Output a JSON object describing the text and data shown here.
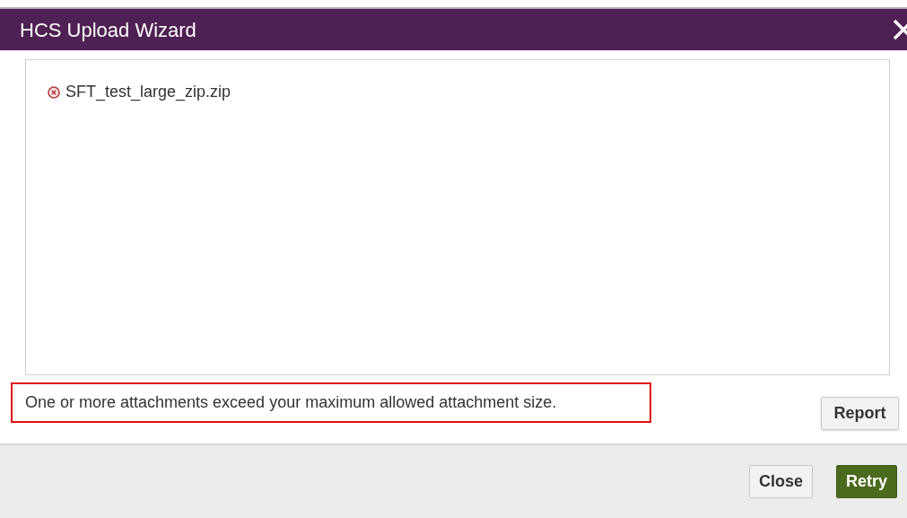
{
  "window": {
    "title": "HCS Upload Wizard"
  },
  "files": [
    {
      "name": "SFT_test_large_zip.zip",
      "failed": true
    }
  ],
  "message": "One or more attachments exceed your maximum allowed attachment size.",
  "report_button": "Report",
  "footer_buttons": [
    {
      "label": "Close",
      "kind": "secondary"
    },
    {
      "label": "Retry",
      "kind": "primary"
    }
  ]
}
